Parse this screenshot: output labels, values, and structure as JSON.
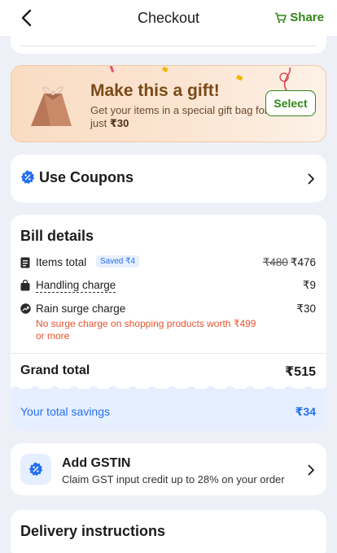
{
  "header": {
    "title": "Checkout",
    "share_label": "Share"
  },
  "gift": {
    "title": "Make this a gift!",
    "subtitle": "Get your items in a special gift bag for just",
    "price": "₹30",
    "select_label": "Select"
  },
  "coupons": {
    "label": "Use Coupons"
  },
  "bill": {
    "title": "Bill details",
    "items_total_label": "Items total",
    "saved_badge": "Saved ₹4",
    "items_total_original": "₹480",
    "items_total_value": "₹476",
    "handling_label": "Handling charge",
    "handling_value": "₹9",
    "surge_label": "Rain surge charge",
    "surge_value": "₹30",
    "surge_note": "No surge charge on shopping products worth ₹499 or more",
    "grand_total_label": "Grand total",
    "grand_total_value": "₹515",
    "savings_label": "Your total savings",
    "savings_value": "₹34"
  },
  "gstin": {
    "title": "Add GSTIN",
    "subtitle": "Claim GST input credit up to 28% on your order"
  },
  "delivery": {
    "title": "Delivery instructions"
  },
  "colors": {
    "green": "#318616",
    "blue": "#256fef",
    "orange": "#e5542d",
    "gift_bg": "#fbe5d2"
  }
}
